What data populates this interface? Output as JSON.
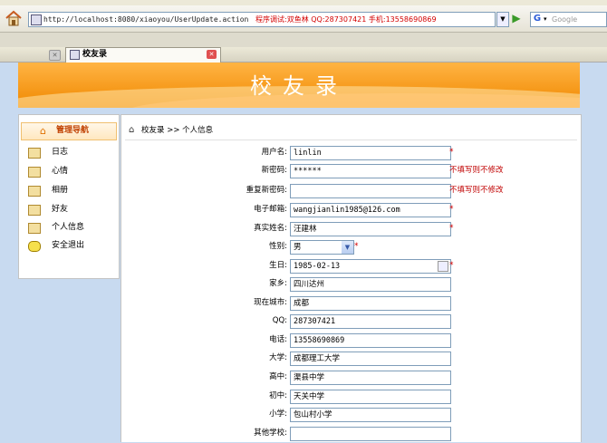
{
  "browser": {
    "url": "http://localhost:8080/xiaoyou/UserUpdate.action",
    "page_title": "程序调试:双鱼林 QQ:287307421 手机:13558690869",
    "search_placeholder": "Google",
    "search_engine": "G",
    "tab_label": "校友录"
  },
  "banner": {
    "title": "校友录"
  },
  "sidebar": {
    "title": "管理导航",
    "items": [
      {
        "label": "日志"
      },
      {
        "label": "心情"
      },
      {
        "label": "相册"
      },
      {
        "label": "好友"
      },
      {
        "label": "个人信息"
      },
      {
        "label": "安全退出"
      }
    ]
  },
  "breadcrumb": {
    "text": "校友录 >> 个人信息"
  },
  "form": {
    "username": {
      "label": "用户名:",
      "value": "linlin",
      "required": "*"
    },
    "new_password": {
      "label": "新密码:",
      "value": "******",
      "hint": "不填写则不修改"
    },
    "confirm_password": {
      "label": "重复新密码:",
      "value": "",
      "hint": "不填写则不修改"
    },
    "email": {
      "label": "电子邮箱:",
      "value": "wangjianlin1985@126.com",
      "required": "*"
    },
    "real_name": {
      "label": "真实姓名:",
      "value": "汪建林",
      "required": "*"
    },
    "gender": {
      "label": "性别:",
      "value": "男",
      "required": "*"
    },
    "birthday": {
      "label": "生日:",
      "value": "1985-02-13",
      "required": "*"
    },
    "hometown": {
      "label": "家乡:",
      "value": "四川达州"
    },
    "city": {
      "label": "现在城市:",
      "value": "成都"
    },
    "qq": {
      "label": "QQ:",
      "value": "287307421"
    },
    "phone": {
      "label": "电话:",
      "value": "13558690869"
    },
    "university": {
      "label": "大学:",
      "value": "成都理工大学"
    },
    "high_school": {
      "label": "高中:",
      "value": "渠县中学"
    },
    "middle_school": {
      "label": "初中:",
      "value": "天关中学"
    },
    "primary_school": {
      "label": "小学:",
      "value": "包山村小学"
    },
    "other_school": {
      "label": "其他学校:",
      "value": ""
    }
  },
  "colors": {
    "banner": "#f08800",
    "required": "#d40000",
    "hint": "#c00000"
  }
}
